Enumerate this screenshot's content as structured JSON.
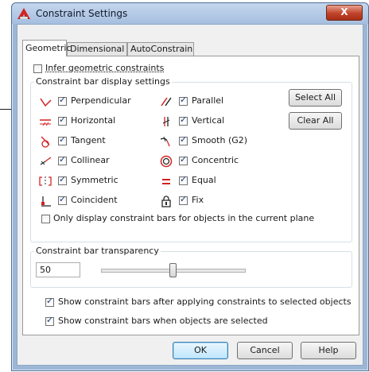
{
  "window": {
    "title": "Constraint Settings",
    "close_glyph": "X"
  },
  "tabs": [
    {
      "label": "Geometric",
      "active": true
    },
    {
      "label": "Dimensional",
      "active": false
    },
    {
      "label": "AutoConstrain",
      "active": false
    }
  ],
  "infer": {
    "label": "Infer geometric constraints",
    "checked": false
  },
  "display_group": {
    "legend": "Constraint bar display settings",
    "left_items": [
      {
        "label": "Perpendicular",
        "icon": "perpendicular-icon",
        "checked": true
      },
      {
        "label": "Horizontal",
        "icon": "horizontal-icon",
        "checked": true
      },
      {
        "label": "Tangent",
        "icon": "tangent-icon",
        "checked": true
      },
      {
        "label": "Collinear",
        "icon": "collinear-icon",
        "checked": true
      },
      {
        "label": "Symmetric",
        "icon": "symmetric-icon",
        "checked": true
      },
      {
        "label": "Coincident",
        "icon": "coincident-icon",
        "checked": true
      }
    ],
    "right_items": [
      {
        "label": "Parallel",
        "icon": "parallel-icon",
        "checked": true
      },
      {
        "label": "Vertical",
        "icon": "vertical-icon",
        "checked": true
      },
      {
        "label": "Smooth (G2)",
        "icon": "smooth-icon",
        "checked": true
      },
      {
        "label": "Concentric",
        "icon": "concentric-icon",
        "checked": true
      },
      {
        "label": "Equal",
        "icon": "equal-icon",
        "checked": true
      },
      {
        "label": "Fix",
        "icon": "fix-lock-icon",
        "checked": true
      }
    ],
    "select_all": "Select All",
    "clear_all": "Clear All",
    "only_current_plane": {
      "label": "Only display constraint bars for objects in the current plane",
      "checked": false
    }
  },
  "transparency_group": {
    "legend": "Constraint bar transparency",
    "value": "50",
    "slider_fraction": 0.5
  },
  "show_after_applying": {
    "label": "Show constraint bars after applying constraints to selected objects",
    "checked": true
  },
  "show_when_selected": {
    "label": "Show constraint bars when objects are selected",
    "checked": true
  },
  "footer": {
    "ok": "OK",
    "cancel": "Cancel",
    "help": "Help"
  },
  "colors": {
    "icon_red": "#d42222",
    "icon_dark": "#2a2a2a",
    "default_button_border": "#3c7fb1"
  }
}
